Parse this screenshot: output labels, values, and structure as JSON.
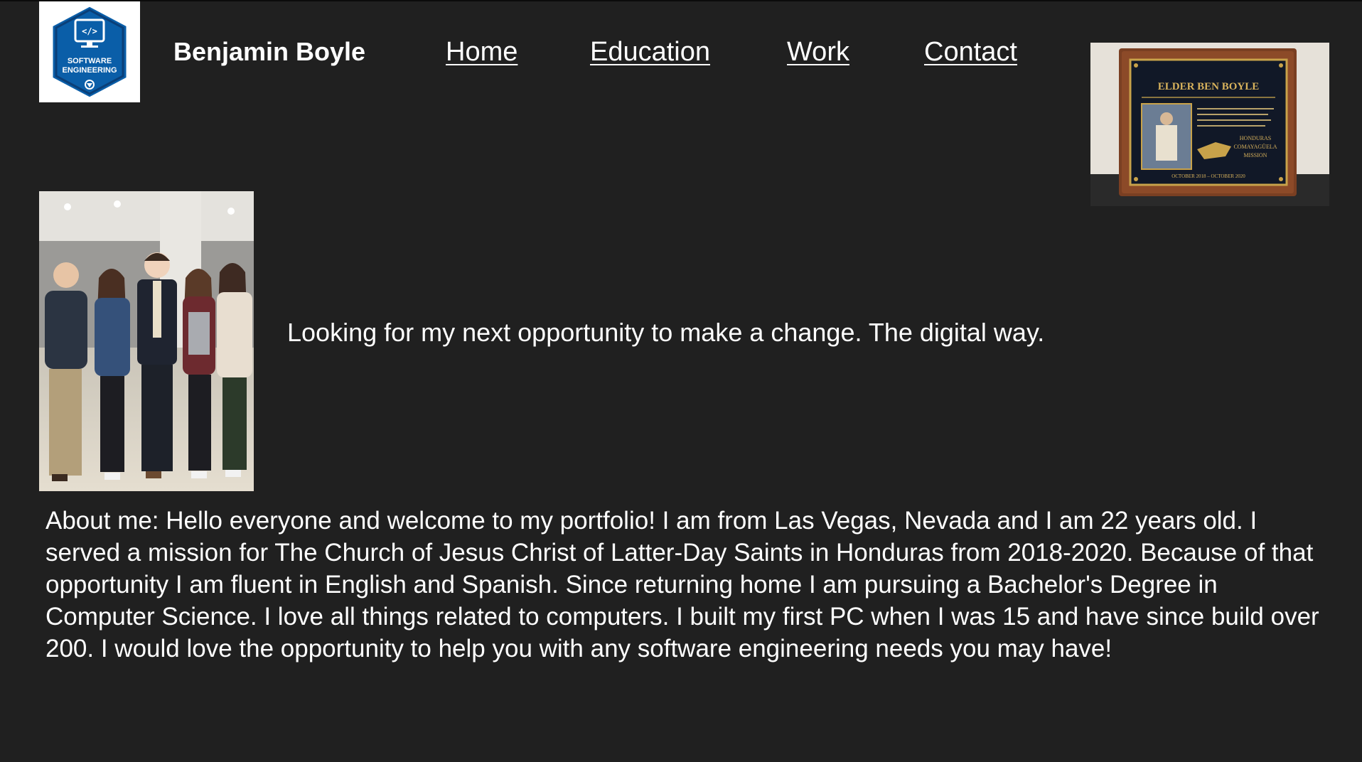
{
  "header": {
    "logo_alt": "Software Engineering logo",
    "logo_text_line1": "SOFTWARE",
    "logo_text_line2": "ENGINEERING",
    "site_name": "Benjamin Boyle"
  },
  "nav": {
    "items": [
      {
        "label": "Home"
      },
      {
        "label": "Education"
      },
      {
        "label": "Work"
      },
      {
        "label": "Contact"
      }
    ]
  },
  "plaque": {
    "title": "ELDER BEN BOYLE",
    "mission_line1": "HONDURAS",
    "mission_line2": "COMAYAGÜELA",
    "mission_line3": "MISSION",
    "dates": "OCTOBER 2018 – OCTOBER 2020"
  },
  "main": {
    "tagline": "Looking for my next opportunity to make a change. The digital way.",
    "about": "About me: Hello everyone and welcome to my portfolio! I am from Las Vegas, Nevada and I am 22 years old. I served a mission for The Church of Jesus Christ of Latter-Day Saints in Honduras from 2018-2020. Because of that opportunity I am fluent in English and Spanish. Since returning home I am pursuing a Bachelor's Degree in Computer Science. I love all things related to computers. I built my first PC when I was 15 and have since build over 200. I would love the opportunity to help you with any software engineering needs you may have!"
  },
  "colors": {
    "background": "#202020",
    "text": "#ffffff",
    "logo_blue": "#0a5ea8"
  }
}
